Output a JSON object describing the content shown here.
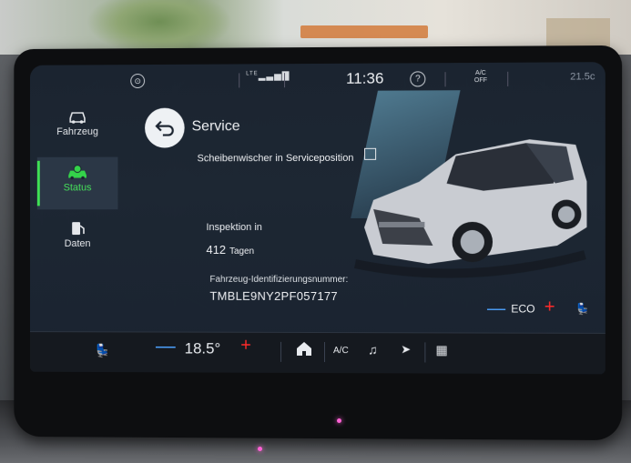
{
  "status_bar": {
    "signal_label": "LTE",
    "time": "11:36",
    "ac_label_top": "A/C",
    "ac_label_bottom": "OFF",
    "outside_temp": "21.5c"
  },
  "sidebar": {
    "items": [
      {
        "label": "Fahrzeug",
        "icon": "car-settings-icon"
      },
      {
        "label": "Status",
        "icon": "car-status-icon",
        "active": true
      },
      {
        "label": "Daten",
        "icon": "fuel-data-icon"
      }
    ]
  },
  "page": {
    "title": "Service",
    "wiper_label": "Scheibenwischer in Serviceposition",
    "inspection_label": "Inspektion in",
    "inspection_days": "412",
    "inspection_unit": "Tagen",
    "vin_label": "Fahrzeug-Identifizierungsnummer:",
    "vin_value": "TMBLE9NY2PF057177"
  },
  "climate": {
    "left_temp": "18.5°",
    "minus_symbol": "—",
    "plus_symbol": "+",
    "right_mode": "ECO",
    "ac_button": "A/C"
  },
  "colors": {
    "accent_green": "#3fe055",
    "minus_blue": "#4da2ff",
    "plus_red": "#ff2a2a"
  }
}
